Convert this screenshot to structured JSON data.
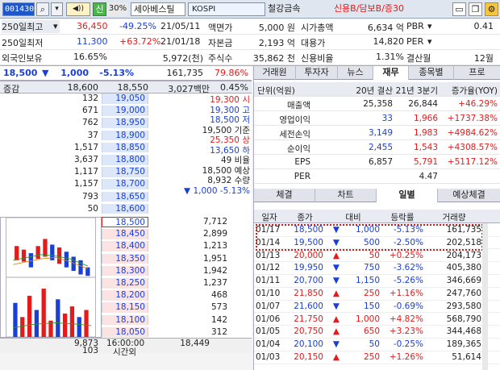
{
  "toolbar": {
    "code": "001430",
    "stock_name": "세아베스틸",
    "market": "KOSPI",
    "sector": "철강금속",
    "credit": "신용B/담보B/증30",
    "pct_badge": "30%",
    "sin": "신",
    "btn_search_icon": "search-icon",
    "btn_sound_icon": "speaker-icon",
    "tool_icons": [
      "window-icon",
      "copy-icon",
      "settings-icon"
    ]
  },
  "info": {
    "r1": {
      "l": "250일최고",
      "v": "36,450",
      "p": "-49.25%",
      "d": "21/05/11",
      "l2": "액면가",
      "v2": "5,000 원",
      "l3": "시가총액",
      "v3": "6,634 억",
      "l4": "PBR",
      "v4": "0.41"
    },
    "r2": {
      "l": "250일최저",
      "v": "11,300",
      "p": "+63.72%",
      "d": "21/01/18",
      "l2": "자본금",
      "v2": "2,193 억",
      "l3": "대용가",
      "v3": "14,820",
      "l4": "PER",
      "v4": ""
    },
    "r3": {
      "l": "외국인보유",
      "v": "16.65%",
      "p": "5,972(천)",
      "l2": "주식수",
      "v2": "35,862 천",
      "l3": "신용비율",
      "v3": "1.31%",
      "l4": "결산월",
      "v4": "12월"
    }
  },
  "price": {
    "cur": "18,500",
    "chg": "1,000",
    "rate": "-5.13%",
    "vol": "161,735",
    "volrate": "79.86%"
  },
  "ob_head": {
    "a": "증감",
    "b": "18,600",
    "c": "18,550",
    "d": "3,027백만",
    "e": "0.45%"
  },
  "asks": [
    {
      "q": "132",
      "p": "19,050"
    },
    {
      "q": "671",
      "p": "19,000"
    },
    {
      "q": "762",
      "p": "18,950"
    },
    {
      "q": "37",
      "p": "18,900"
    },
    {
      "q": "1,517",
      "p": "18,850"
    },
    {
      "q": "3,637",
      "p": "18,800"
    },
    {
      "q": "1,117",
      "p": "18,750"
    },
    {
      "q": "1,157",
      "p": "18,700"
    },
    {
      "q": "793",
      "p": "18,650"
    },
    {
      "q": "50",
      "p": "18,600"
    }
  ],
  "stats": [
    {
      "v": "19,300 시"
    },
    {
      "v": "19,300 고"
    },
    {
      "v": "18,500 저"
    },
    {
      "v": "19,500 기준"
    },
    {
      "v": "25,350 상"
    },
    {
      "v": "13,650 하"
    },
    {
      "v": "49 비율"
    },
    {
      "v": "18,500 예상"
    },
    {
      "v": "8,932 수량"
    },
    {
      "v": "▼  1,000     -5.13%"
    }
  ],
  "bids": [
    {
      "p": "18,500",
      "q": "7,712"
    },
    {
      "p": "18,450",
      "q": "2,899"
    },
    {
      "p": "18,400",
      "q": "1,213"
    },
    {
      "p": "18,350",
      "q": "1,951"
    },
    {
      "p": "18,300",
      "q": "1,942"
    },
    {
      "p": "18,250",
      "q": "1,237"
    },
    {
      "p": "18,200",
      "q": "468"
    },
    {
      "p": "18,150",
      "q": "573"
    },
    {
      "p": "18,100",
      "q": "142"
    },
    {
      "p": "18,050",
      "q": "312"
    }
  ],
  "foot": {
    "a": "9,873",
    "b": "16:00:00",
    "c": "18,449",
    "d": "103",
    "e": "시간외"
  },
  "tabs1": [
    "거래원",
    "투자자",
    "뉴스",
    "재무",
    "종목별",
    "프로"
  ],
  "fin_head": {
    "a": "단위(억원)",
    "b": "20년 결산",
    "c": "21년 3분기",
    "d": "증가율(YOY)"
  },
  "fin": [
    {
      "n": "매출액",
      "a": "25,358",
      "b": "26,844",
      "c": "+46.29%"
    },
    {
      "n": "영업이익",
      "a": "33",
      "b": "1,966",
      "c": "+1737.38%"
    },
    {
      "n": "세전손익",
      "a": "3,149",
      "b": "1,983",
      "c": "+4984.62%"
    },
    {
      "n": "순이익",
      "a": "2,455",
      "b": "1,543",
      "c": "+4308.57%"
    },
    {
      "n": "EPS",
      "a": "6,857",
      "b": "5,791",
      "c": "+5117.12%"
    },
    {
      "n": "PER",
      "a": "",
      "b": "4.47",
      "c": ""
    }
  ],
  "tabs2": [
    "체결",
    "차트",
    "일별",
    "예상체결"
  ],
  "daily_head": {
    "a": "일자",
    "b": "종가",
    "c": "대비",
    "d": "등락률",
    "e": "거래량"
  },
  "daily": [
    {
      "d": "01/17",
      "p": "18,500",
      "s": "▼",
      "c": "1,000",
      "r": "-5.13%",
      "v": "161,735",
      "up": false
    },
    {
      "d": "01/14",
      "p": "19,500",
      "s": "▼",
      "c": "500",
      "r": "-2.50%",
      "v": "202,518",
      "up": false
    },
    {
      "d": "01/13",
      "p": "20,000",
      "s": "▲",
      "c": "50",
      "r": "+0.25%",
      "v": "204,173",
      "up": true
    },
    {
      "d": "01/12",
      "p": "19,950",
      "s": "▼",
      "c": "750",
      "r": "-3.62%",
      "v": "405,380",
      "up": false
    },
    {
      "d": "01/11",
      "p": "20,700",
      "s": "▼",
      "c": "1,150",
      "r": "-5.26%",
      "v": "346,669",
      "up": false
    },
    {
      "d": "01/10",
      "p": "21,850",
      "s": "▲",
      "c": "250",
      "r": "+1.16%",
      "v": "247,760",
      "up": true
    },
    {
      "d": "01/07",
      "p": "21,600",
      "s": "▼",
      "c": "150",
      "r": "-0.69%",
      "v": "293,580",
      "up": false
    },
    {
      "d": "01/06",
      "p": "21,750",
      "s": "▲",
      "c": "1,000",
      "r": "+4.82%",
      "v": "568,790",
      "up": true
    },
    {
      "d": "01/05",
      "p": "20,750",
      "s": "▲",
      "c": "650",
      "r": "+3.23%",
      "v": "344,468",
      "up": true
    },
    {
      "d": "01/04",
      "p": "20,100",
      "s": "▼",
      "c": "50",
      "r": "-0.25%",
      "v": "189,365",
      "up": false
    },
    {
      "d": "01/03",
      "p": "20,150",
      "s": "▲",
      "c": "250",
      "r": "+1.26%",
      "v": "51,614",
      "up": true
    }
  ]
}
